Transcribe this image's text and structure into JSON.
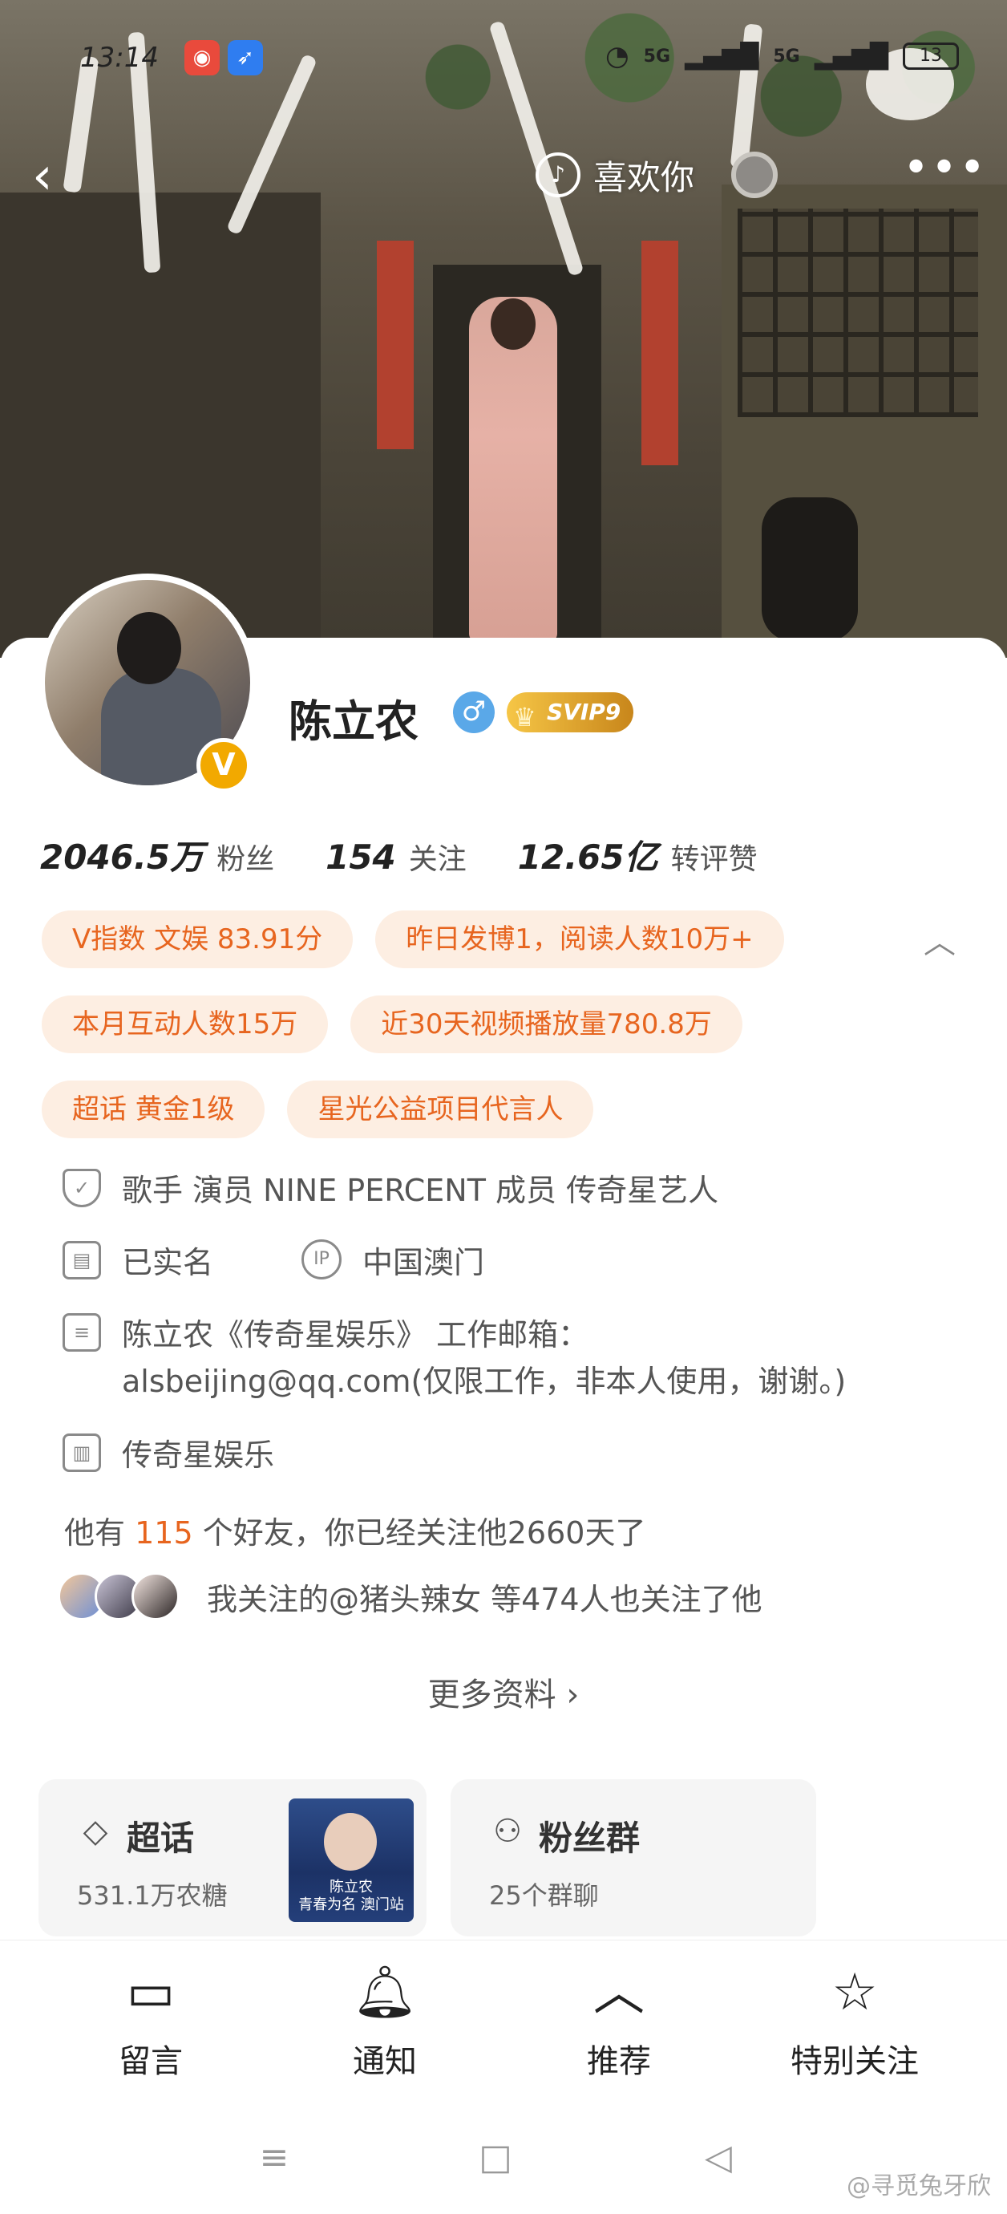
{
  "status_bar": {
    "time": "13:14",
    "signal_1": "5G",
    "signal_2": "5G",
    "battery": "13"
  },
  "top_nav": {
    "song_label": "喜欢你"
  },
  "profile": {
    "name": "陈立农",
    "gender_symbol": "♂",
    "vip_label": "SVIP9",
    "verified_badge": "V"
  },
  "stats": [
    {
      "value": "2046.5万",
      "label": "粉丝"
    },
    {
      "value": "154",
      "label": "关注"
    },
    {
      "value": "12.65亿",
      "label": "转评赞"
    }
  ],
  "tags": {
    "row1": [
      "V指数 文娱 83.91分",
      "昨日发博1，阅读人数10万+"
    ],
    "row2": [
      "本月互动人数15万",
      "近30天视频播放量780.8万"
    ],
    "row3": [
      "超话 黄金1级",
      "星光公益项目代言人"
    ]
  },
  "info": {
    "title_line": "歌手 演员 NINE PERCENT 成员 传奇星艺人",
    "verified": "已实名",
    "ip_location": "中国澳门",
    "bio_line1": "陈立农《传奇星娱乐》 工作邮箱：",
    "bio_line2": "alsbeijing@qq.com(仅限工作，非本人使用，谢谢。)",
    "company": "传奇星娱乐"
  },
  "friends": {
    "prefix": "他有",
    "count": "115",
    "suffix": "个好友，你已经关注他2660天了"
  },
  "mutual": {
    "text": "我关注的@猪头辣女 等474人也关注了他"
  },
  "more_info": "更多资料 ›",
  "boxes": {
    "supertopic": {
      "title": "超话",
      "sub": "531.1万农糖",
      "poster_text": "陈立农\n青春为名 澳门站"
    },
    "fangroup": {
      "title": "粉丝群",
      "sub": "25个群聊"
    }
  },
  "tabbar": [
    {
      "label": "留言"
    },
    {
      "label": "通知"
    },
    {
      "label": "推荐"
    },
    {
      "label": "特别关注"
    }
  ],
  "watermark": "@寻觅兔牙欣",
  "colors": {
    "accent": "#e7651f",
    "tag_bg": "#fdeee2",
    "vip_gold": "#f2a900",
    "gender_blue": "#5aa8e8"
  }
}
